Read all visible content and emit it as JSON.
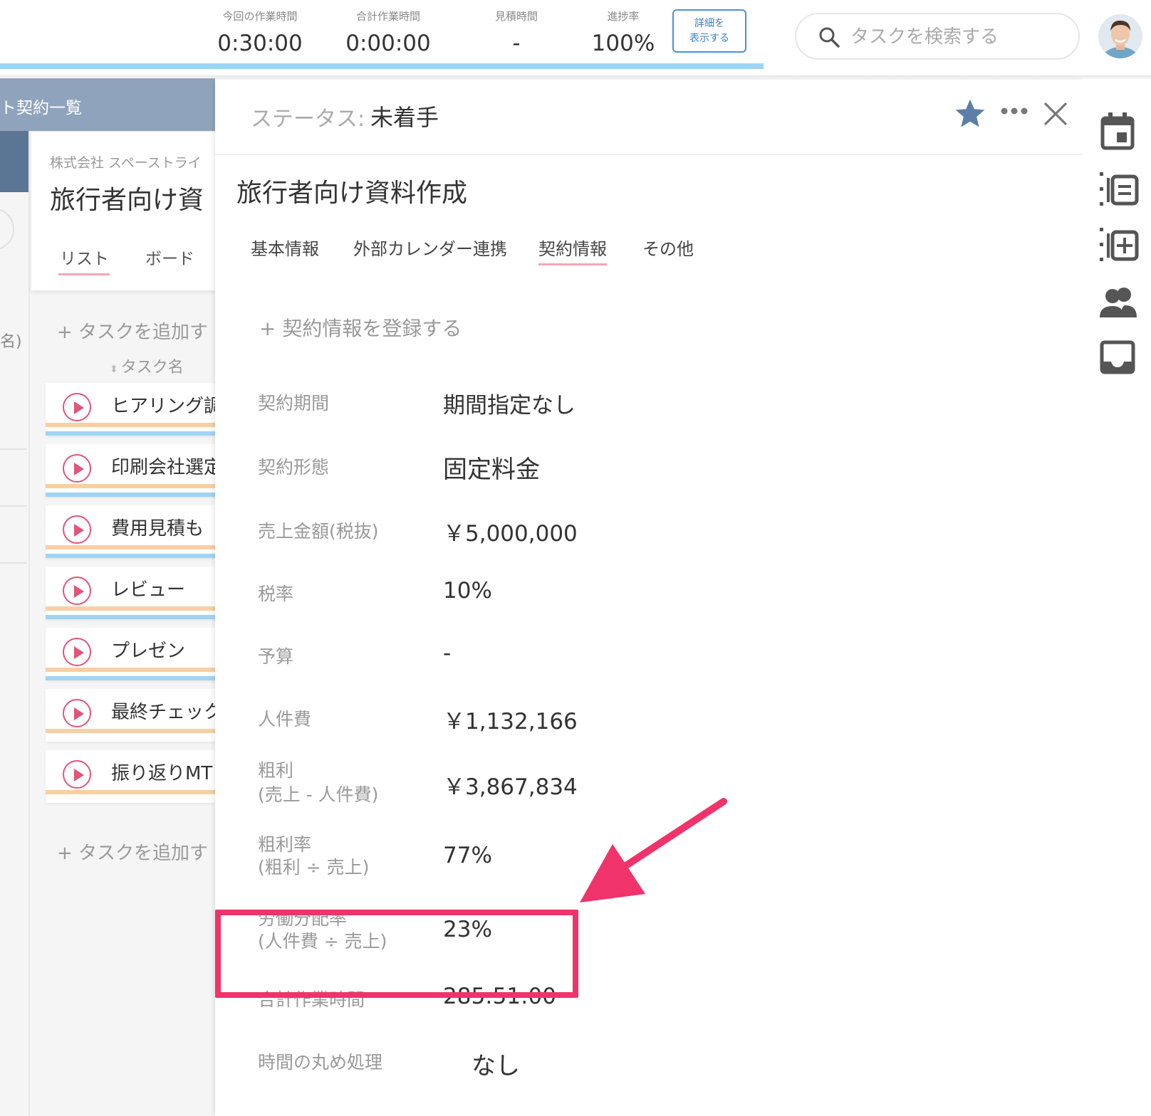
{
  "header": {
    "stats": [
      {
        "label": "今回の作業時間",
        "value": "0:30:00"
      },
      {
        "label": "合計作業時間",
        "value": "0:00:00"
      },
      {
        "label": "見積時間",
        "value": "-"
      },
      {
        "label": "進捗率",
        "value": "100%"
      }
    ],
    "detail_button": {
      "line1": "詳細を",
      "line2": "表示する"
    },
    "search_placeholder": "タスクを検索する"
  },
  "project": {
    "banner_title": "ト契約一覧",
    "client": "株式会社 スペーストライ",
    "name": "旅行者向け資",
    "tabs": [
      "リスト",
      "ボード"
    ],
    "add_task": "+ タスクを追加す",
    "sort_column": "タスク名",
    "partial_text": "名)",
    "tasks": [
      {
        "name": "ヒアリング調"
      },
      {
        "name": "印刷会社選定"
      },
      {
        "name": "費用見積も"
      },
      {
        "name": "レビュー"
      },
      {
        "name": "プレゼン"
      },
      {
        "name": "最終チェック"
      },
      {
        "name": "振り返りMT"
      }
    ]
  },
  "detail": {
    "status_label": "ステータス:",
    "status_value": "未着手",
    "title": "旅行者向け資料作成",
    "tabs": [
      "基本情報",
      "外部カレンダー連携",
      "契約情報",
      "その他"
    ],
    "active_tab": "契約情報",
    "register_link": "+ 契約情報を登録する",
    "fields": [
      {
        "label": "契約期間",
        "value": "期間指定なし"
      },
      {
        "label": "契約形態",
        "value": "固定料金"
      },
      {
        "label": "売上金額(税抜)",
        "value": "￥5,000,000"
      },
      {
        "label": "税率",
        "value": "10%"
      },
      {
        "label": "予算",
        "value": "-"
      },
      {
        "label": "人件費",
        "value": "￥1,132,166"
      },
      {
        "label": "粗利",
        "sublabel": "(売上 - 人件費)",
        "value": "￥3,867,834"
      },
      {
        "label": "粗利率",
        "sublabel": "(粗利 ÷ 売上)",
        "value": "77%"
      },
      {
        "label": "労働分配率",
        "sublabel": "(人件費 ÷ 売上)",
        "value": "23%"
      },
      {
        "label": "合計作業時間",
        "value": "285:51:00"
      },
      {
        "label": "時間の丸め処理",
        "value": "なし"
      }
    ]
  },
  "colors": {
    "accent_blue": "#4a90d9",
    "progress_bar": "#9fd4f5",
    "highlight": "#f0336a",
    "star": "#5b7fa8",
    "play": "#e0567a",
    "banner": "#8fa4bc"
  },
  "icons": [
    "search-icon",
    "star-icon",
    "more-icon",
    "close-icon",
    "calendar-icon",
    "list-icon",
    "add-list-icon",
    "people-icon",
    "inbox-icon",
    "play-icon"
  ]
}
